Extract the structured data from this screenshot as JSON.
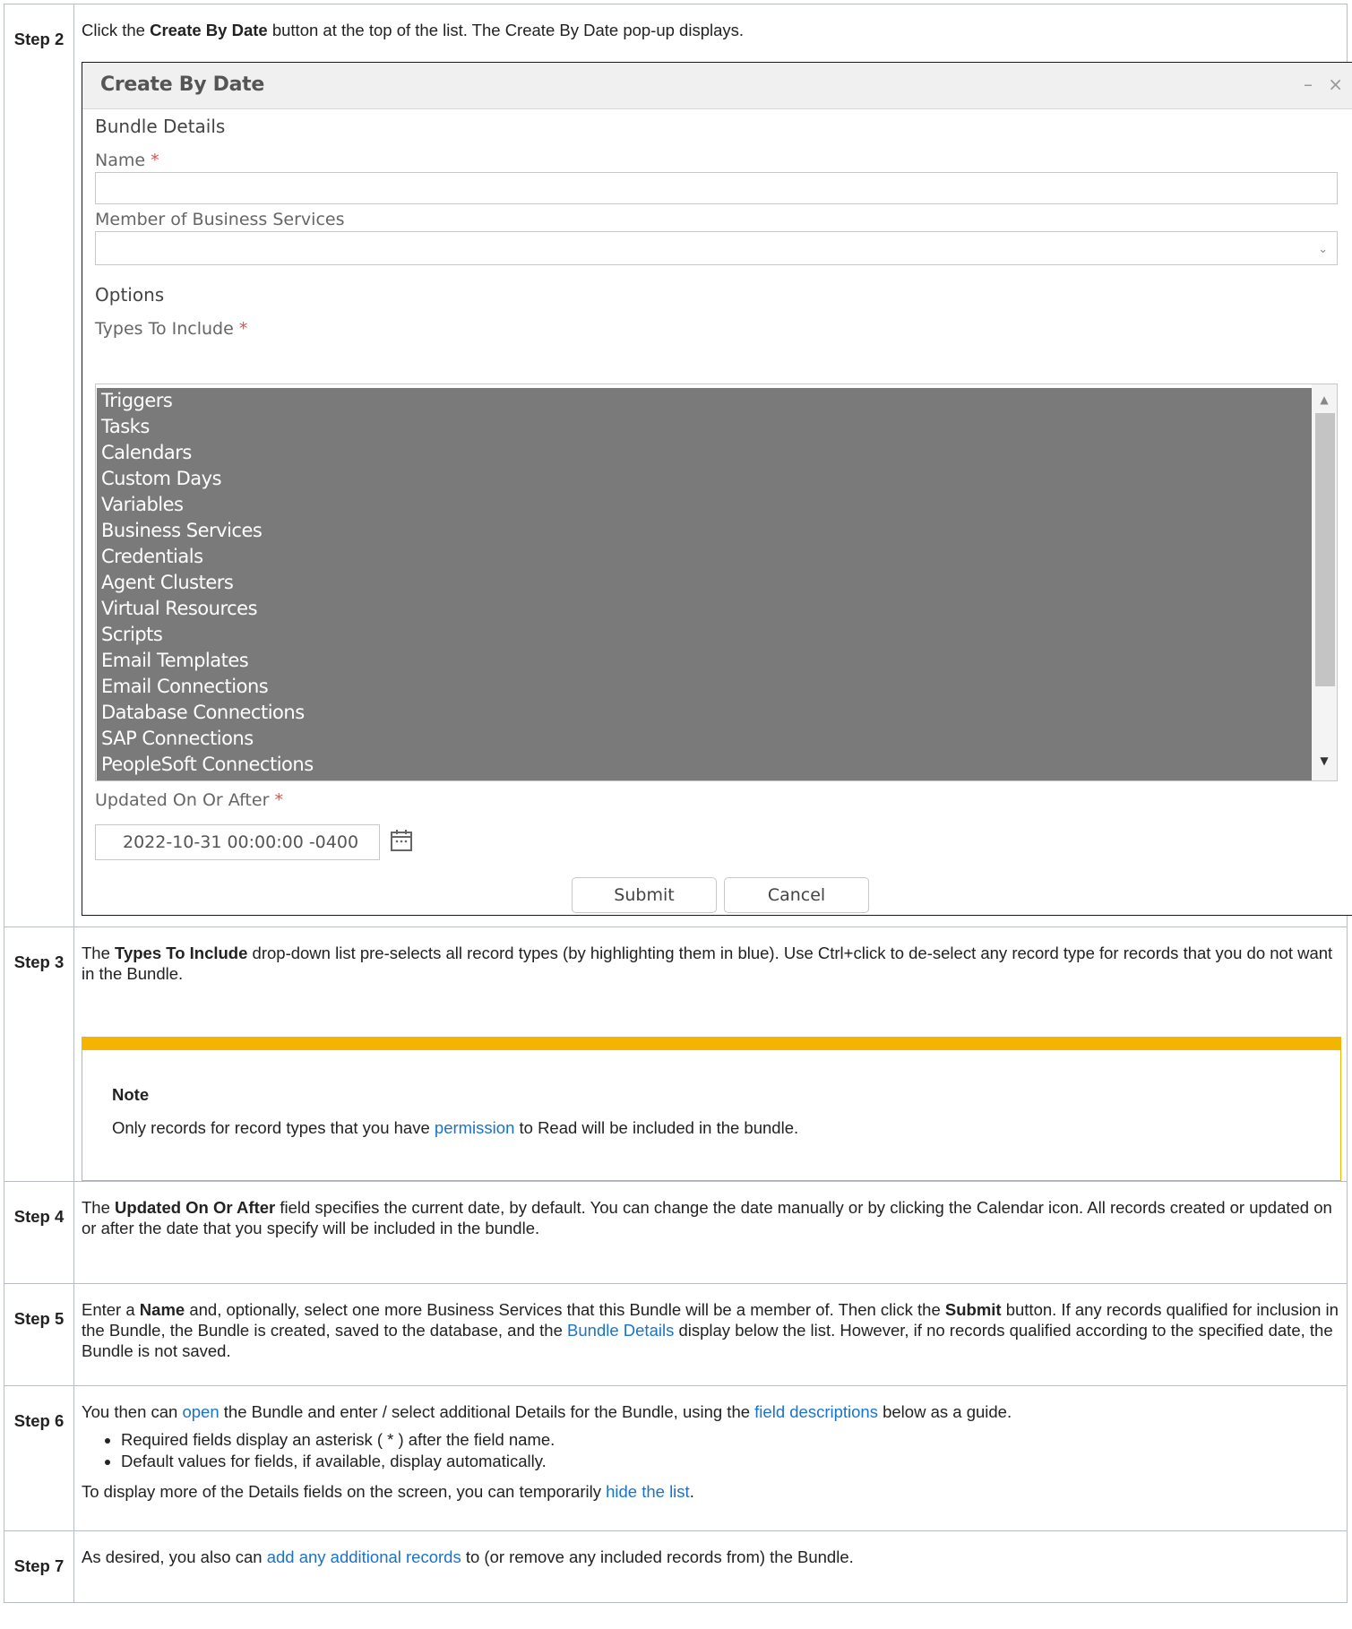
{
  "rows": {
    "step2": {
      "step": "Step 2",
      "t1": "Click the ",
      "b1": "Create By Date",
      "t2": " button at the top of the list. The Create By Date pop-up displays."
    },
    "step3": {
      "step": "Step 3",
      "t1": "The ",
      "b1": "Types To Include",
      "t2": " drop-down list pre-selects all record types (by highlighting them in blue). Use Ctrl+click to de-select any record type for records that you do not want in the Bundle.",
      "note_title": "Note",
      "note_t1": "Only records for record types that you have ",
      "note_link": "permission",
      "note_t2": " to Read will be included in the bundle."
    },
    "step4": {
      "step": "Step 4",
      "t1": "The ",
      "b1": "Updated On Or After",
      "t2": " field specifies the current date, by default. You can change the date manually or by clicking the Calendar icon. All records created or updated on or after the date that you specify will be included in the bundle."
    },
    "step5": {
      "step": "Step 5",
      "t1": "Enter a ",
      "b1": "Name",
      "t2": " and, optionally, select one more Business Services that this Bundle will be a member of. Then click the ",
      "b2": "Submit",
      "t3": " button. If any records qualified for inclusion in the Bundle, the Bundle is created, saved to the database, and the ",
      "link1": "Bundle Details",
      "t4": " display below the list. However, if no records qualified according to the specified date, the Bundle is not saved."
    },
    "step6": {
      "step": "Step 6",
      "t1": "You then can ",
      "link1": "open",
      "t2": " the Bundle and enter / select additional Details for the Bundle, using the ",
      "link2": "field descriptions",
      "t3": " below as a guide.",
      "bullets": [
        "Required fields display an asterisk ( * ) after the field name.",
        "Default values for fields, if available, display automatically."
      ],
      "p2_t1": "To display more of the Details fields on the screen, you can temporarily ",
      "p2_link": "hide the list",
      "p2_t2": "."
    },
    "step7": {
      "step": "Step 7",
      "t1": "As desired, you also can ",
      "link1": "add any additional records",
      "t2": " to (or remove any included records from) the Bundle."
    }
  },
  "dialog": {
    "title": "Create By Date",
    "min_icon": "minimize-icon",
    "close_icon": "close-icon",
    "section_details": "Bundle Details",
    "name_label": "Name",
    "required_mark": "*",
    "name_value": "",
    "member_label": "Member of Business Services",
    "member_value": "",
    "section_options": "Options",
    "types_label": "Types To Include",
    "types": [
      "Triggers",
      "Tasks",
      "Calendars",
      "Custom Days",
      "Variables",
      "Business Services",
      "Credentials",
      "Agent Clusters",
      "Virtual Resources",
      "Scripts",
      "Email Templates",
      "Email Connections",
      "Database Connections",
      "SAP Connections",
      "PeopleSoft Connections"
    ],
    "updated_label": "Updated On Or After",
    "updated_value": "2022-10-31 00:00:00 -0400",
    "calendar_icon": "calendar-icon",
    "submit_label": "Submit",
    "cancel_label": "Cancel"
  },
  "colors": {
    "link": "#1a73c9",
    "note_accent": "#f4b400",
    "selected_item_bg": "#7a7a7a",
    "required": "#d9534f"
  }
}
